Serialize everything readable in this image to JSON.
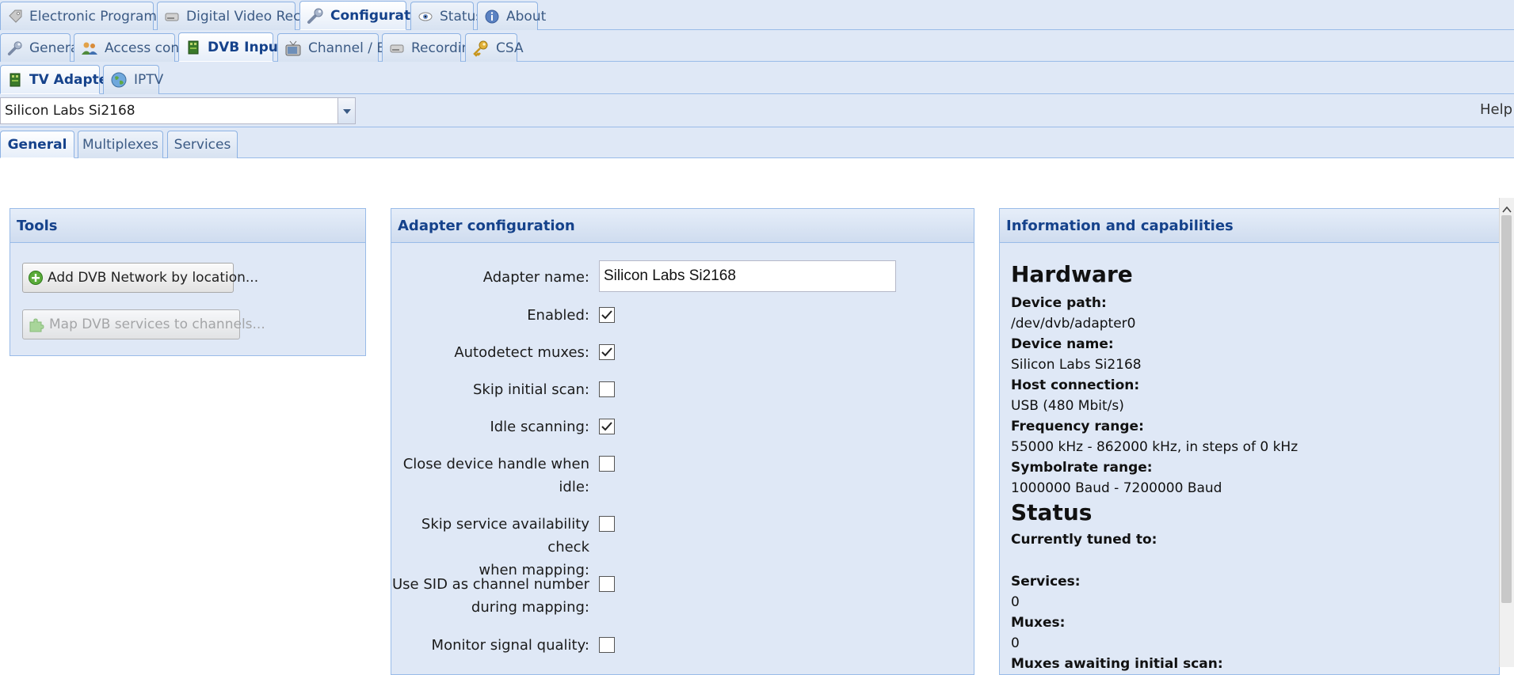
{
  "top_tabs": [
    {
      "label": "Electronic Program Guide",
      "icon": "tag-icon"
    },
    {
      "label": "Digital Video Recorder",
      "icon": "hard-drive-icon"
    },
    {
      "label": "Configuration",
      "icon": "wrench-icon"
    },
    {
      "label": "Status",
      "icon": "eye-icon"
    },
    {
      "label": "About",
      "icon": "info-icon"
    }
  ],
  "config_tabs": [
    {
      "label": "General",
      "icon": "wrench-icon"
    },
    {
      "label": "Access control",
      "icon": "users-icon"
    },
    {
      "label": "DVB Inputs",
      "icon": "card-icon"
    },
    {
      "label": "Channel / EPG",
      "icon": "tv-icon"
    },
    {
      "label": "Recording",
      "icon": "hard-drive-icon"
    },
    {
      "label": "CSA",
      "icon": "key-icon"
    }
  ],
  "input_tabs": [
    {
      "label": "TV Adapters",
      "icon": "card-icon"
    },
    {
      "label": "IPTV",
      "icon": "globe-icon"
    }
  ],
  "adapter_select": {
    "value": "Silicon Labs Si2168"
  },
  "help_label": "Help",
  "adapter_tabs": [
    "General",
    "Multiplexes",
    "Services"
  ],
  "tools": {
    "title": "Tools",
    "add_button": "Add DVB Network by location...",
    "map_button": "Map DVB services to channels..."
  },
  "adapter_config": {
    "title": "Adapter configuration",
    "name_label": "Adapter name:",
    "name_value": "Silicon Labs Si2168",
    "fields": [
      {
        "label": "Enabled:",
        "line2": "",
        "checked": true
      },
      {
        "label": "Autodetect muxes:",
        "line2": "",
        "checked": true
      },
      {
        "label": "Skip initial scan:",
        "line2": "",
        "checked": false
      },
      {
        "label": "Idle scanning:",
        "line2": "",
        "checked": true
      },
      {
        "label": "Close device handle when",
        "line2": "idle:",
        "checked": false
      },
      {
        "label": "Skip service availability check",
        "line2": "when mapping:",
        "checked": false
      },
      {
        "label": "Use SID as channel number",
        "line2": "during mapping:",
        "checked": false
      },
      {
        "label": "Monitor signal quality:",
        "line2": "",
        "checked": false
      }
    ]
  },
  "info": {
    "title": "Information and capabilities",
    "hardware_title": "Hardware",
    "device_path_label": "Device path:",
    "device_path": "/dev/dvb/adapter0",
    "device_name_label": "Device name:",
    "device_name": "Silicon Labs Si2168",
    "host_label": "Host connection:",
    "host": "USB (480 Mbit/s)",
    "freq_label": "Frequency range:",
    "freq": "55000 kHz - 862000 kHz, in steps of 0 kHz",
    "symbol_label": "Symbolrate range:",
    "symbol": "1000000 Baud - 7200000 Baud",
    "status_title": "Status",
    "tuned_label": "Currently tuned to:",
    "tuned": "",
    "services_label": "Services:",
    "services": "0",
    "muxes_label": "Muxes:",
    "muxes": "0",
    "awaiting_label": "Muxes awaiting initial scan:"
  },
  "colors": {
    "accent": "#15428b",
    "border": "#99bbe8",
    "panel": "#dfe8f6"
  }
}
